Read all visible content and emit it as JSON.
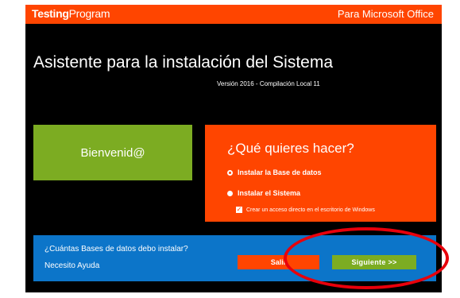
{
  "header": {
    "brand_bold": "Testing",
    "brand_regular": "Program",
    "product": "Para Microsoft Office"
  },
  "main": {
    "title": "Asistente para la instalación del Sistema",
    "version": "Versión 2016 - Compilación Local 11",
    "welcome": "Bienvenid@"
  },
  "options": {
    "question": "¿Qué quieres hacer?",
    "items": [
      {
        "label": "Instalar la Base de datos",
        "selected": true
      },
      {
        "label": "Instalar el Sistema",
        "selected": false
      }
    ],
    "shortcut": {
      "label": "Crear un acceso directo en el escritorio de Windows",
      "checked": true
    }
  },
  "footer": {
    "question": "¿Cuántas Bases de datos debo instalar?",
    "help": "Necesito Ayuda",
    "exit_label": "Salir",
    "next_label": "Siguiente >>"
  },
  "colors": {
    "accent_orange": "#ff4500",
    "accent_green": "#7cac22",
    "footer_blue": "#0c75c9",
    "highlight_red": "#e8000b"
  }
}
